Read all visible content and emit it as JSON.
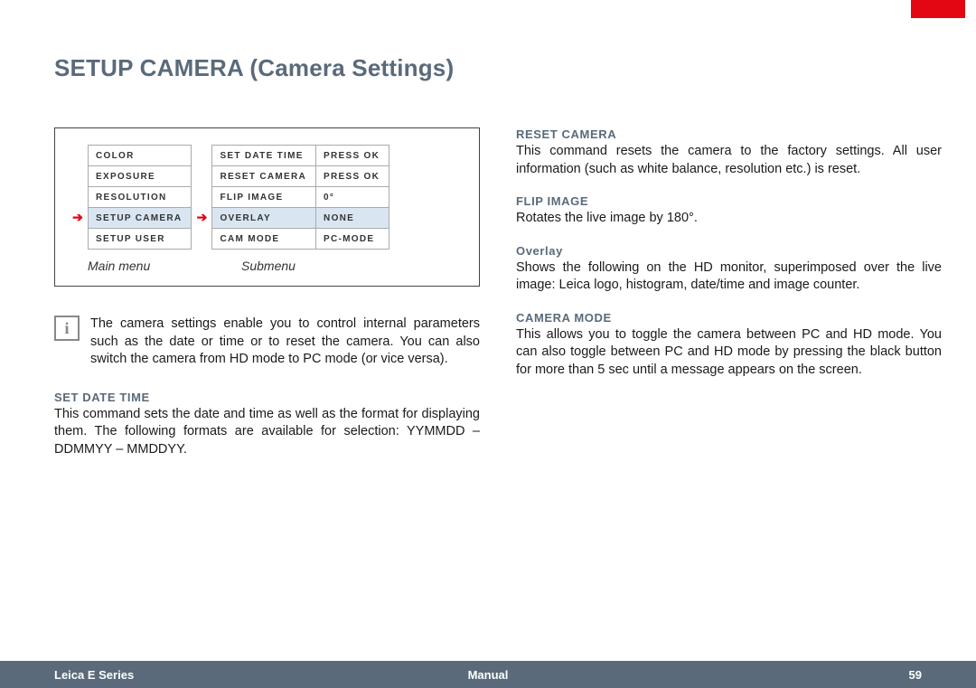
{
  "title": "SETUP CAMERA (Camera Settings)",
  "main_menu": {
    "label": "Main menu",
    "items": [
      "Color",
      "Exposure",
      "Resolution",
      "Setup Camera",
      "Setup User"
    ],
    "selected_index": 3
  },
  "sub_menu": {
    "label": "Submenu",
    "rows": [
      {
        "k": "Set Date Time",
        "v": "Press OK"
      },
      {
        "k": "Reset Camera",
        "v": "Press OK"
      },
      {
        "k": "Flip Image",
        "v": "0°"
      },
      {
        "k": "Overlay",
        "v": "None"
      },
      {
        "k": "Cam Mode",
        "v": "Pc-Mode"
      }
    ],
    "selected_index": 3
  },
  "intro": "The camera settings enable you to control internal parameters such as the date or time or to reset the camera. You can also switch the camera from HD mode to PC mode (or vice versa).",
  "sections": {
    "set_date_time": {
      "title": "SET DATE TIME",
      "body": "This command sets the date and time as well as the format for displaying them. The following formats are available for selection: YYMMDD – DDMMYY – MMDDYY."
    },
    "reset_camera": {
      "title": "RESET CAMERA",
      "body": "This command resets the camera to the factory settings. All user information (such as white balance, resolution etc.) is reset."
    },
    "flip_image": {
      "title": "FLIP IMAGE",
      "body": "Rotates the live image by 180°."
    },
    "overlay": {
      "title": "Overlay",
      "body": "Shows the following on the HD monitor, superimposed over the live image: Leica logo, histogram, date/time and image counter."
    },
    "camera_mode": {
      "title": "CAMERA MODE",
      "body": "This allows you to toggle the camera between PC and HD mode. You can also toggle between PC and HD mode by pressing the black button for more than 5 sec until a message appears on the screen."
    }
  },
  "footer": {
    "left": "Leica E Series",
    "mid": "Manual",
    "right": "59"
  }
}
